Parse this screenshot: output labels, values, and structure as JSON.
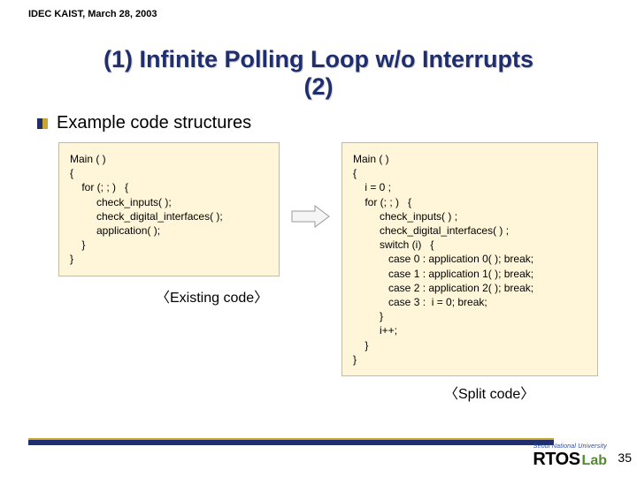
{
  "header": {
    "venue": "IDEC KAIST, March 28, 2003"
  },
  "title": {
    "line1": "(1) Infinite Polling Loop w/o Interrupts",
    "line2": "(2)"
  },
  "bullet": {
    "text": "Example code structures"
  },
  "code": {
    "left": "Main ( )\n{\n    for (; ; )   {\n         check_inputs( );\n         check_digital_interfaces( );\n         application( );\n    }\n}",
    "left_caption": "〈Existing code〉",
    "right": "Main ( )\n{\n    i = 0 ;\n    for (; ; )   {\n         check_inputs( ) ;\n         check_digital_interfaces( ) ;\n         switch (i)   {\n            case 0 : application 0( ); break;\n            case 1 : application 1( ); break;\n            case 2 : application 2( ); break;\n            case 3 :  i = 0; break;\n         }\n         i++;\n    }\n}",
    "right_caption": "〈Split code〉"
  },
  "footer": {
    "university": "Seoul National University",
    "lab_main": "RTOS",
    "lab_sub": "Lab",
    "page": "35"
  },
  "colors": {
    "navy": "#1f2e6f",
    "gold": "#c9a42e",
    "codebg": "#fff6da",
    "green": "#548a2f"
  }
}
